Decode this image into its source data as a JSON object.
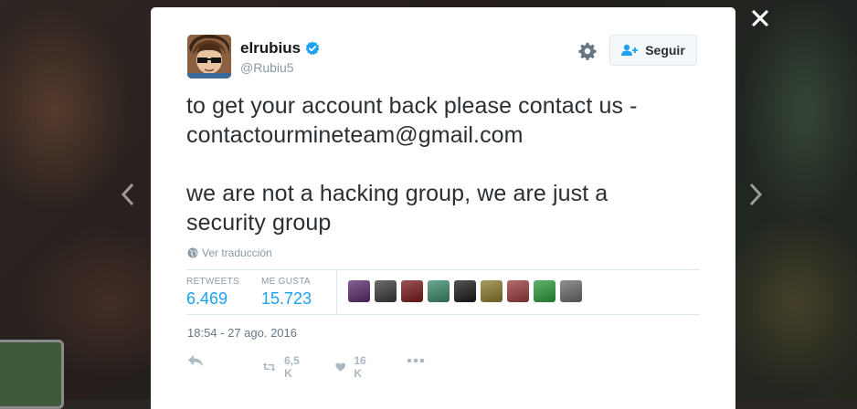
{
  "tweet": {
    "user": {
      "name": "elrubius",
      "handle": "@Rubiu5",
      "verified": true
    },
    "follow_label": "Seguir",
    "text_lines": [
      "to get your account back please contact us -",
      "contactourmineteam@gmail.com",
      "",
      "we are not a hacking group, we are just a",
      "security group"
    ],
    "translate_label": "Ver traducción",
    "stats": {
      "retweets_label": "RETWEETS",
      "retweets_value": "6.469",
      "likes_label": "ME GUSTA",
      "likes_value": "15.723"
    },
    "liker_avatars": [
      {
        "color": "#5a2a6e"
      },
      {
        "color": "#3a3a3a"
      },
      {
        "color": "#7a1a1a"
      },
      {
        "color": "#3a8a6a"
      },
      {
        "color": "#1a1a1a"
      },
      {
        "color": "#8a7a2a"
      },
      {
        "color": "#9a3a3a"
      },
      {
        "color": "#2a9a3a"
      },
      {
        "color": "#6a6a6a"
      }
    ],
    "timestamp": "18:54 - 27 ago. 2016",
    "actions": {
      "retweet_count": "6,5 K",
      "like_count": "16 K"
    }
  },
  "colors": {
    "accent": "#1da1f2",
    "verified": "#1da1f2",
    "muted": "#8899a6"
  },
  "icons": {
    "verified": "verified-badge-icon",
    "gear": "gear-icon",
    "follow": "add-user-icon",
    "globe": "globe-icon",
    "reply": "reply-icon",
    "retweet": "retweet-icon",
    "like": "heart-icon",
    "more": "more-dots-icon",
    "close": "close-icon",
    "prev": "chevron-left-icon",
    "next": "chevron-right-icon"
  }
}
